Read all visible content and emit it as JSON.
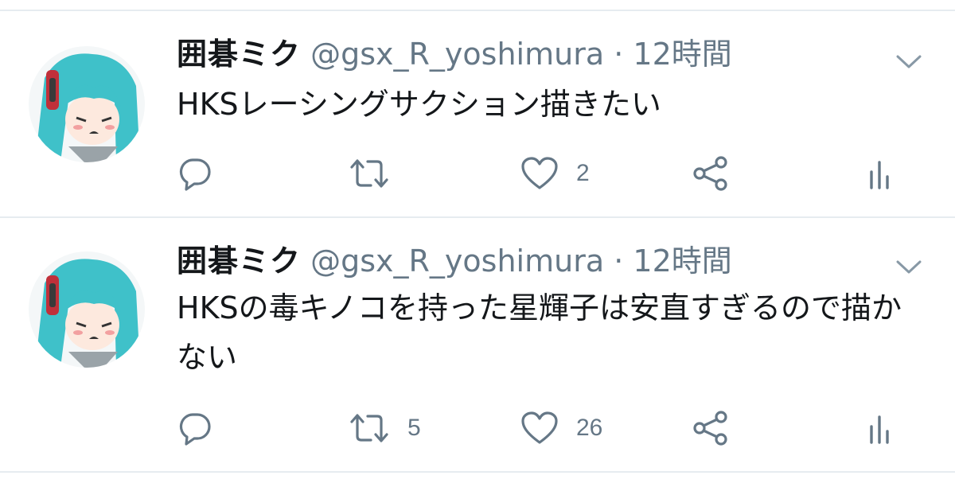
{
  "colors": {
    "text": "#14171a",
    "secondary": "#657786",
    "divider": "#e6ecf0",
    "avatar_hair": "#3fc1c9"
  },
  "tweets": [
    {
      "display_name": "囲碁ミク",
      "handle": "@gsx_R_yoshimura",
      "separator": "·",
      "time": "12時間",
      "text": "HKSレーシングサクション描きたい",
      "reply_count": "",
      "retweet_count": "",
      "like_count": "2",
      "icons": [
        "reply-icon",
        "retweet-icon",
        "like-icon",
        "share-icon",
        "analytics-icon",
        "chevron-down-icon"
      ]
    },
    {
      "display_name": "囲碁ミク",
      "handle": "@gsx_R_yoshimura",
      "separator": "·",
      "time": "12時間",
      "text": "HKSの毒キノコを持った星輝子は安直すぎるので描かない",
      "reply_count": "",
      "retweet_count": "5",
      "like_count": "26",
      "icons": [
        "reply-icon",
        "retweet-icon",
        "like-icon",
        "share-icon",
        "analytics-icon",
        "chevron-down-icon"
      ]
    }
  ]
}
